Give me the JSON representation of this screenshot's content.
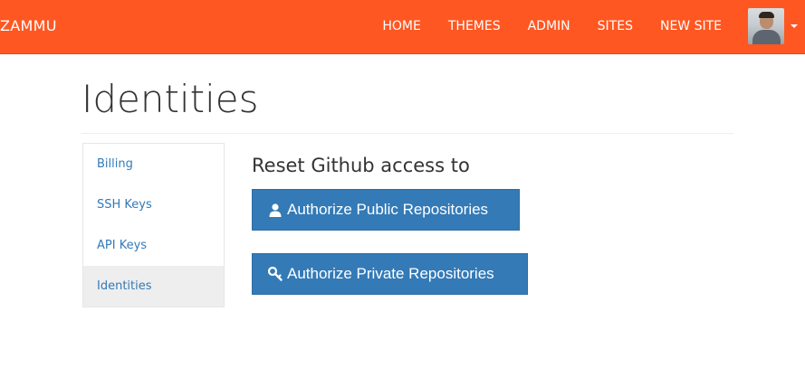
{
  "navbar": {
    "brand": "ZAMMU",
    "links": [
      "HOME",
      "THEMES",
      "ADMIN",
      "SITES",
      "NEW SITE"
    ],
    "avatar_icon": "user-avatar",
    "dropdown_icon": "caret-down-icon"
  },
  "page": {
    "title": "Identities"
  },
  "sidebar": {
    "items": [
      {
        "label": "Billing",
        "active": false
      },
      {
        "label": "SSH Keys",
        "active": false
      },
      {
        "label": "API Keys",
        "active": false
      },
      {
        "label": "Identities",
        "active": true
      }
    ]
  },
  "main": {
    "heading": "Reset Github access to",
    "buttons": [
      {
        "label": "Authorize Public Repositories",
        "icon": "user-icon"
      },
      {
        "label": "Authorize Private Repositories",
        "icon": "key-icon"
      }
    ]
  },
  "colors": {
    "navbar": "#ff5722",
    "primary_button": "#337ab7",
    "link": "#337ab7",
    "active_item": "#eeeeee"
  }
}
